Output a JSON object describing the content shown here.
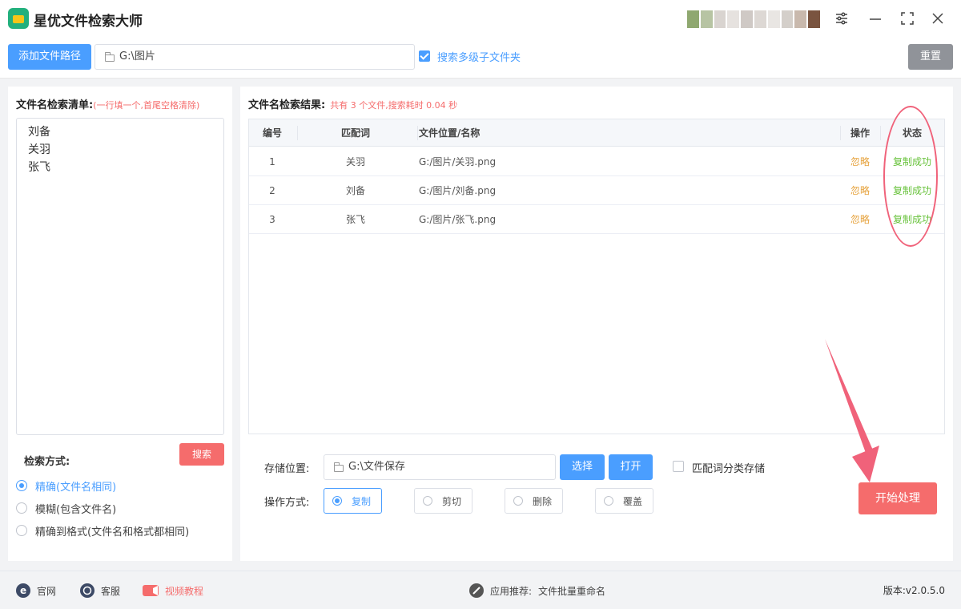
{
  "app": {
    "title": "星优文件检索大师"
  },
  "toolbar": {
    "add_path_label": "添加文件路径",
    "path_value": "G:\\图片",
    "include_subfolders_label": "搜索多级子文件夹",
    "include_subfolders_checked": true,
    "reset_label": "重置"
  },
  "search_list": {
    "title": "文件名检索清单:",
    "hint": "(一行填一个,首尾空格清除)",
    "names": [
      "刘备",
      "关羽",
      "张飞"
    ],
    "names_text": "刘备\n关羽\n张飞"
  },
  "search_mode": {
    "label": "检索方式:",
    "search_button": "搜索",
    "options": [
      {
        "label": "精确(文件名相同)",
        "selected": true
      },
      {
        "label": "模糊(包含文件名)",
        "selected": false
      },
      {
        "label": "精确到格式(文件名和格式都相同)",
        "selected": false
      }
    ]
  },
  "results": {
    "title": "文件名检索结果:",
    "summary": "共有 3 个文件,搜索耗时 0.04 秒",
    "columns": {
      "no": "编号",
      "word": "匹配词",
      "path": "文件位置/名称",
      "op": "操作",
      "status": "状态"
    },
    "rows": [
      {
        "no": "1",
        "word": "关羽",
        "path": "G:/图片/关羽.png",
        "op": "忽略",
        "status": "复制成功"
      },
      {
        "no": "2",
        "word": "刘备",
        "path": "G:/图片/刘备.png",
        "op": "忽略",
        "status": "复制成功"
      },
      {
        "no": "3",
        "word": "张飞",
        "path": "G:/图片/张飞.png",
        "op": "忽略",
        "status": "复制成功"
      }
    ]
  },
  "storage": {
    "label": "存储位置:",
    "value": "G:\\文件保存",
    "choose_label": "选择",
    "open_label": "打开",
    "classify_label": "匹配词分类存储",
    "classify_checked": false
  },
  "operation": {
    "label": "操作方式:",
    "options": [
      {
        "label": "复制",
        "selected": true
      },
      {
        "label": "剪切",
        "selected": false
      },
      {
        "label": "删除",
        "selected": false
      },
      {
        "label": "覆盖",
        "selected": false
      }
    ],
    "start_label": "开始处理"
  },
  "footer": {
    "website": "官网",
    "support": "客服",
    "video": "视频教程",
    "recommend_label": "应用推荐:",
    "recommend_app": "文件批量重命名",
    "version": "版本:v2.0.5.0"
  },
  "colors": {
    "primary": "#4a9eff",
    "danger": "#f56c6c",
    "warning": "#e6a23c",
    "success": "#67c23a",
    "annotation": "#f0627a"
  },
  "icons": {
    "logo": "wallet-icon",
    "settings": "sliders-icon",
    "minimize": "minimize-icon",
    "maximize": "fullscreen-icon",
    "close": "close-icon",
    "folder": "folder-icon",
    "website": "ie-icon",
    "support": "chat-icon",
    "video": "video-camera-icon",
    "link": "link-icon"
  }
}
